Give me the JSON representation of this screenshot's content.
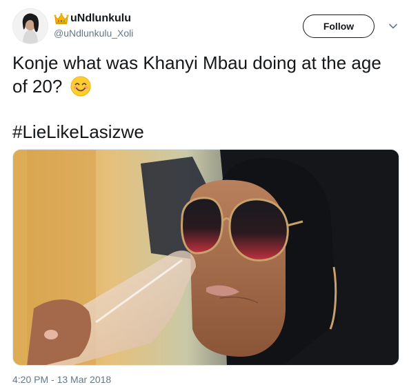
{
  "author": {
    "display_name": "uNdlunkulu",
    "handle": "@uNdlunkulu_Xoli",
    "avatar_icon": "profile-photo",
    "badge_icon": "crown-emoji"
  },
  "actions": {
    "follow_label": "Follow",
    "menu_icon": "chevron-down-icon"
  },
  "tweet": {
    "text": "Konje what was Khanyi Mbau doing at the age of 20?",
    "emoji": "smiling-face-with-smiling-eyes",
    "hashtag": "#LieLikeLasizwe"
  },
  "media": {
    "type": "photo"
  },
  "meta": {
    "timestamp": "4:20 PM - 13 Mar 2018"
  },
  "colors": {
    "text": "#14171a",
    "secondary": "#657786",
    "border": "#e1e8ed"
  }
}
